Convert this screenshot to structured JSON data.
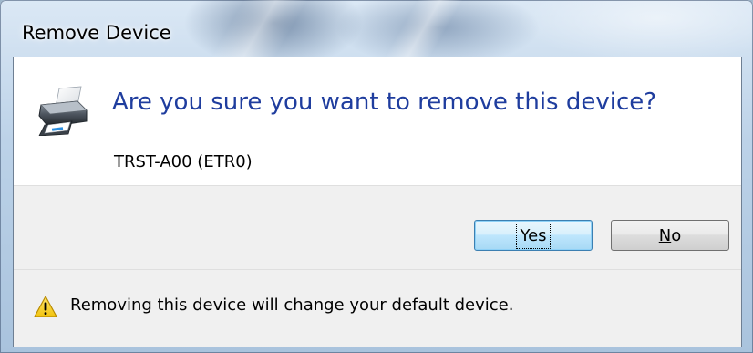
{
  "window": {
    "title": "Remove Device"
  },
  "dialog": {
    "question": "Are you sure you want to remove this device?",
    "device_name": "TRST-A00 (ETR0)",
    "device_icon": "printer-icon"
  },
  "buttons": {
    "yes": {
      "label": "Yes",
      "mnemonic": "",
      "rest": "Yes",
      "is_default": true
    },
    "no": {
      "mnemonic": "N",
      "rest": "o"
    }
  },
  "footer": {
    "icon": "warning-icon",
    "message": "Removing this device will change your default device."
  },
  "colors": {
    "question_text": "#1f3d9e",
    "default_button_border": "#3c7fb1",
    "warning_yellow": "#f7d21e"
  }
}
